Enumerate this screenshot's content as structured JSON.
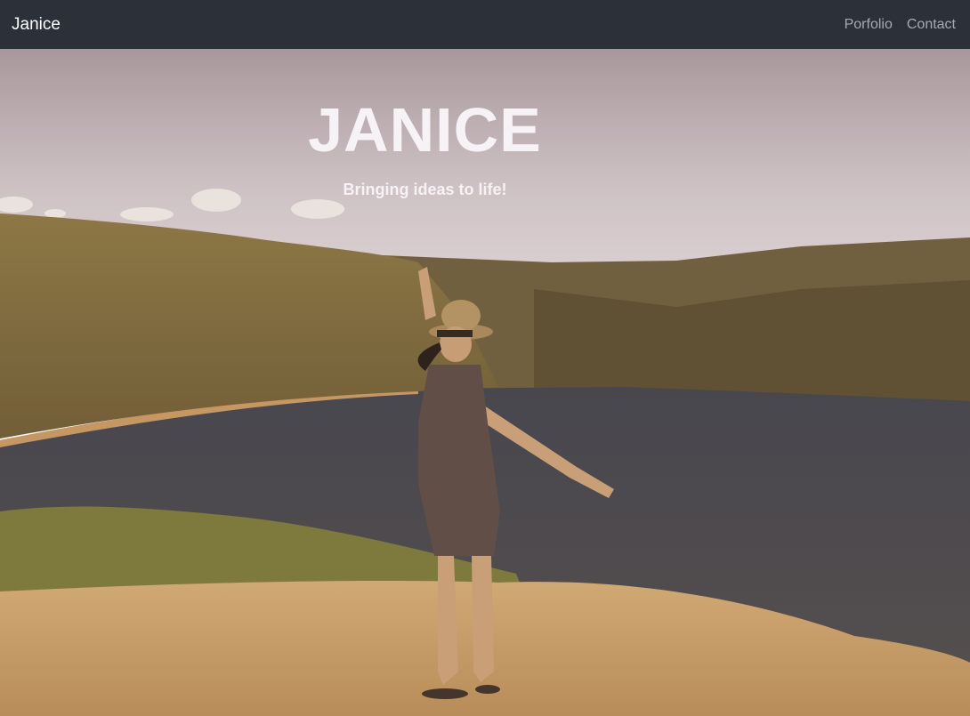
{
  "navbar": {
    "brand": "Janice",
    "links": [
      {
        "label": "Porfolio"
      },
      {
        "label": "Contact"
      }
    ]
  },
  "hero": {
    "title": "JANICE",
    "subtitle": "Bringing ideas to life!"
  },
  "colors": {
    "navbar_bg": "#2b3039",
    "nav_link": "#a7aab0",
    "hero_text": "#f6f2f6"
  }
}
